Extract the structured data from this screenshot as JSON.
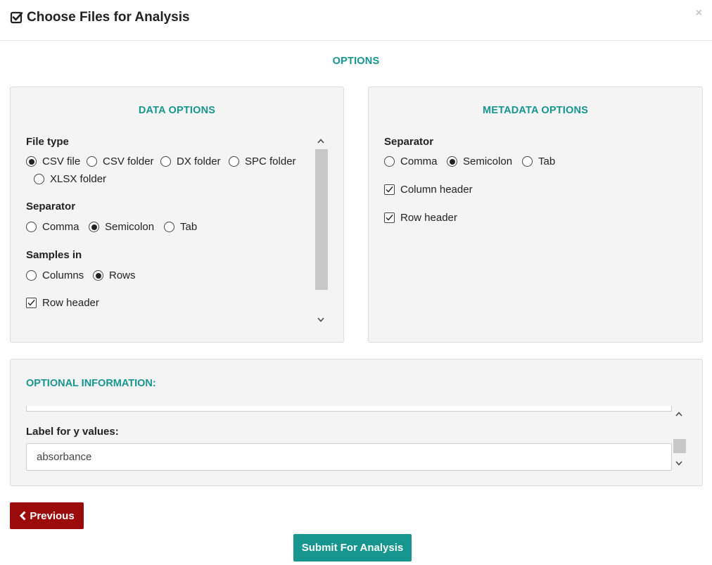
{
  "header": {
    "title": "Choose Files for Analysis",
    "title_icon": "check-square-icon",
    "close_label": "×"
  },
  "options_title": "OPTIONS",
  "data_options": {
    "title": "DATA OPTIONS",
    "file_type": {
      "label": "File type",
      "options": [
        "CSV file",
        "CSV folder",
        "DX folder",
        "SPC folder",
        "XLSX folder"
      ],
      "selected": "CSV file"
    },
    "separator": {
      "label": "Separator",
      "options": [
        "Comma",
        "Semicolon",
        "Tab"
      ],
      "selected": "Semicolon"
    },
    "samples_in": {
      "label": "Samples in",
      "options": [
        "Columns",
        "Rows"
      ],
      "selected": "Rows"
    },
    "row_header": {
      "label": "Row header",
      "checked": true
    }
  },
  "metadata_options": {
    "title": "METADATA OPTIONS",
    "separator": {
      "label": "Separator",
      "options": [
        "Comma",
        "Semicolon",
        "Tab"
      ],
      "selected": "Semicolon"
    },
    "column_header": {
      "label": "Column header",
      "checked": true
    },
    "row_header": {
      "label": "Row header",
      "checked": true
    }
  },
  "optional_info": {
    "title": "OPTIONAL INFORMATION:",
    "y_label": "Label for y values:",
    "y_value": "absorbance"
  },
  "buttons": {
    "previous": "Previous",
    "submit": "Submit For Analysis"
  },
  "colors": {
    "accent": "#16968f",
    "danger": "#9b0b0b"
  }
}
